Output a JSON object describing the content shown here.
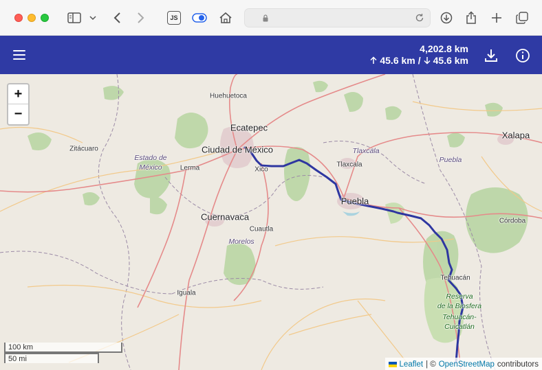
{
  "browser": {
    "js_badge": "JS"
  },
  "header": {
    "total_distance": "4,202.8 km",
    "ascent": "45.6 km",
    "separator": "/",
    "descent": "45.6 km"
  },
  "map": {
    "zoom_in": "+",
    "zoom_out": "−",
    "scale_km": "100 km",
    "scale_mi": "50 mi",
    "attribution": {
      "leaflet": "Leaflet",
      "separator": "| ©",
      "osm": "OpenStreetMap",
      "suffix": "contributors"
    },
    "places": {
      "huehuetoca": "Huehuetoca",
      "ecatepec": "Ecatepec",
      "cdmx": "Ciudad de México",
      "zitacuaro": "Zitácuaro",
      "estado1": "Estado de",
      "estado2": "México",
      "lerma": "Lerma",
      "xico": "Xico",
      "tlaxcala_city": "Tlaxcala",
      "tlaxcala_state": "Tlaxcala",
      "xalapa": "Xalapa",
      "puebla_state": "Puebla",
      "puebla_city": "Puebla",
      "cordoba": "Córdoba",
      "cuernavaca": "Cuernavaca",
      "cuautla": "Cuautla",
      "morelos": "Morelos",
      "tehuacan": "Tehuacán",
      "reserva1": "Reserva",
      "reserva2": "de la Biosfera",
      "reserva3": "Tehuacán-",
      "reserva4": "Cuicatlán",
      "iguala": "Iguala"
    },
    "colors": {
      "route": "#2e36a0",
      "header": "#2f3aa4",
      "land": "#eeeae2",
      "forest": "#b9d6a4",
      "park": "#c9dfb2",
      "urban": "#e3cfd0",
      "major_road": "#e58a8a",
      "minor_road": "#f2c98a",
      "border": "#9b8aa6"
    }
  }
}
